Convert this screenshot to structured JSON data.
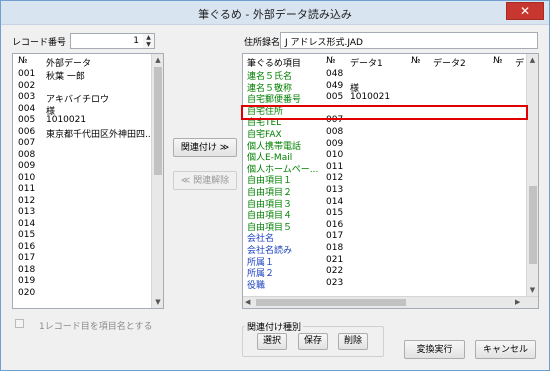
{
  "window": {
    "title": "筆ぐるめ - 外部データ読み込み",
    "close": "✕"
  },
  "left": {
    "record_label": "レコード番号",
    "record_value": "1",
    "columns": [
      "№",
      "外部データ"
    ],
    "rows": [
      {
        "no": "001",
        "data": "秋葉 一郎"
      },
      {
        "no": "002",
        "data": ""
      },
      {
        "no": "003",
        "data": "アキバイチロウ"
      },
      {
        "no": "004",
        "data": "様"
      },
      {
        "no": "005",
        "data": "1010021"
      },
      {
        "no": "006",
        "data": "東京都千代田区外神田四..."
      },
      {
        "no": "007",
        "data": ""
      },
      {
        "no": "008",
        "data": ""
      },
      {
        "no": "009",
        "data": ""
      },
      {
        "no": "010",
        "data": ""
      },
      {
        "no": "011",
        "data": ""
      },
      {
        "no": "012",
        "data": ""
      },
      {
        "no": "013",
        "data": ""
      },
      {
        "no": "014",
        "data": ""
      },
      {
        "no": "015",
        "data": ""
      },
      {
        "no": "016",
        "data": ""
      },
      {
        "no": "017",
        "data": ""
      },
      {
        "no": "018",
        "data": ""
      },
      {
        "no": "019",
        "data": ""
      },
      {
        "no": "020",
        "data": ""
      }
    ],
    "checkbox_label": "1レコード目を項目名とする"
  },
  "middle": {
    "link_button": "関連付け ≫",
    "unlink_button": "≪ 関連解除"
  },
  "right": {
    "address_label": "住所録名",
    "address_value": "J アドレス形式.JAD",
    "columns": [
      "筆ぐるめ項目",
      "№",
      "データ1",
      "№",
      "データ2",
      "№",
      "デ"
    ],
    "rows": [
      {
        "item": "連名５氏名",
        "no": "048",
        "data1": "",
        "color": "#008000"
      },
      {
        "item": "連名５敬称",
        "no": "049",
        "data1": "様",
        "color": "#008000"
      },
      {
        "item": "自宅郵便番号",
        "no": "005",
        "data1": "1010021",
        "color": "#008000"
      },
      {
        "item": "自宅住所",
        "no": "",
        "data1": "",
        "color": "#008000"
      },
      {
        "item": "自宅TEL",
        "no": "007",
        "data1": "",
        "color": "#008000"
      },
      {
        "item": "自宅FAX",
        "no": "008",
        "data1": "",
        "color": "#008000"
      },
      {
        "item": "個人携帯電話",
        "no": "009",
        "data1": "",
        "color": "#008000"
      },
      {
        "item": "個人E-Mail",
        "no": "010",
        "data1": "",
        "color": "#008000"
      },
      {
        "item": "個人ホームペー...",
        "no": "011",
        "data1": "",
        "color": "#008000"
      },
      {
        "item": "自由項目１",
        "no": "012",
        "data1": "",
        "color": "#008000"
      },
      {
        "item": "自由項目２",
        "no": "013",
        "data1": "",
        "color": "#008000"
      },
      {
        "item": "自由項目３",
        "no": "014",
        "data1": "",
        "color": "#008000"
      },
      {
        "item": "自由項目４",
        "no": "015",
        "data1": "",
        "color": "#008000"
      },
      {
        "item": "自由項目５",
        "no": "016",
        "data1": "",
        "color": "#008000"
      },
      {
        "item": "会社名",
        "no": "017",
        "data1": "",
        "color": "#1a3fc0"
      },
      {
        "item": "会社名読み",
        "no": "018",
        "data1": "",
        "color": "#1a3fc0"
      },
      {
        "item": "所属１",
        "no": "021",
        "data1": "",
        "color": "#1a3fc0"
      },
      {
        "item": "所属２",
        "no": "022",
        "data1": "",
        "color": "#1a3fc0"
      },
      {
        "item": "役職",
        "no": "023",
        "data1": "",
        "color": "#1a3fc0"
      }
    ]
  },
  "bottom": {
    "group_label": "関連付け種別",
    "select": "選択",
    "save": "保存",
    "delete": "削除",
    "execute": "変換実行",
    "cancel": "キャンセル"
  },
  "colors": {
    "highlight": "#e00000",
    "green_item": "#008000",
    "blue_item": "#1a3fc0",
    "title_bar": "#d9e4f1"
  }
}
